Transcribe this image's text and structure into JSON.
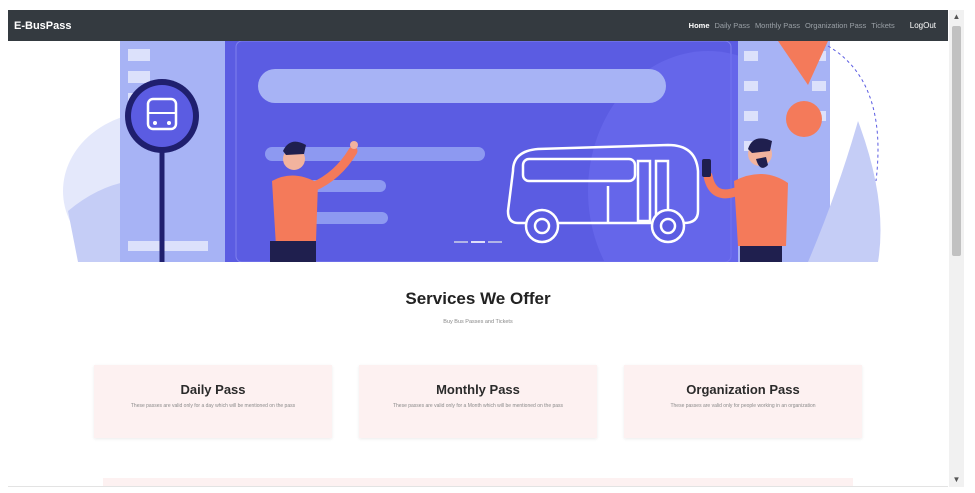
{
  "navbar": {
    "brand": "E-BusPass",
    "links": [
      {
        "label": "Home"
      },
      {
        "label": "Daily Pass"
      },
      {
        "label": "Monthly Pass"
      },
      {
        "label": "Organization Pass"
      },
      {
        "label": "Tickets"
      }
    ],
    "logout": "LogOut"
  },
  "carousel": {
    "slides": 3,
    "active_slide": 2
  },
  "services": {
    "title": "Services We Offer",
    "subtitle": "Buy Bus Passes and Tickets"
  },
  "cards": [
    {
      "title": "Daily Pass",
      "description": "These passes are valid only for a day which will be mentioned on the pass"
    },
    {
      "title": "Monthly Pass",
      "description": "These passes are valid only for a Month which will be mentioned on the pass"
    },
    {
      "title": "Organization Pass",
      "description": "These passes are valid only for people working in an organization"
    }
  ],
  "colors": {
    "navbar": "#343a40",
    "hero_purple": "#5b5ce2",
    "hero_light": "#a7b3f5",
    "accent_coral": "#f47a5a",
    "card_bg": "#fdf1f1"
  }
}
